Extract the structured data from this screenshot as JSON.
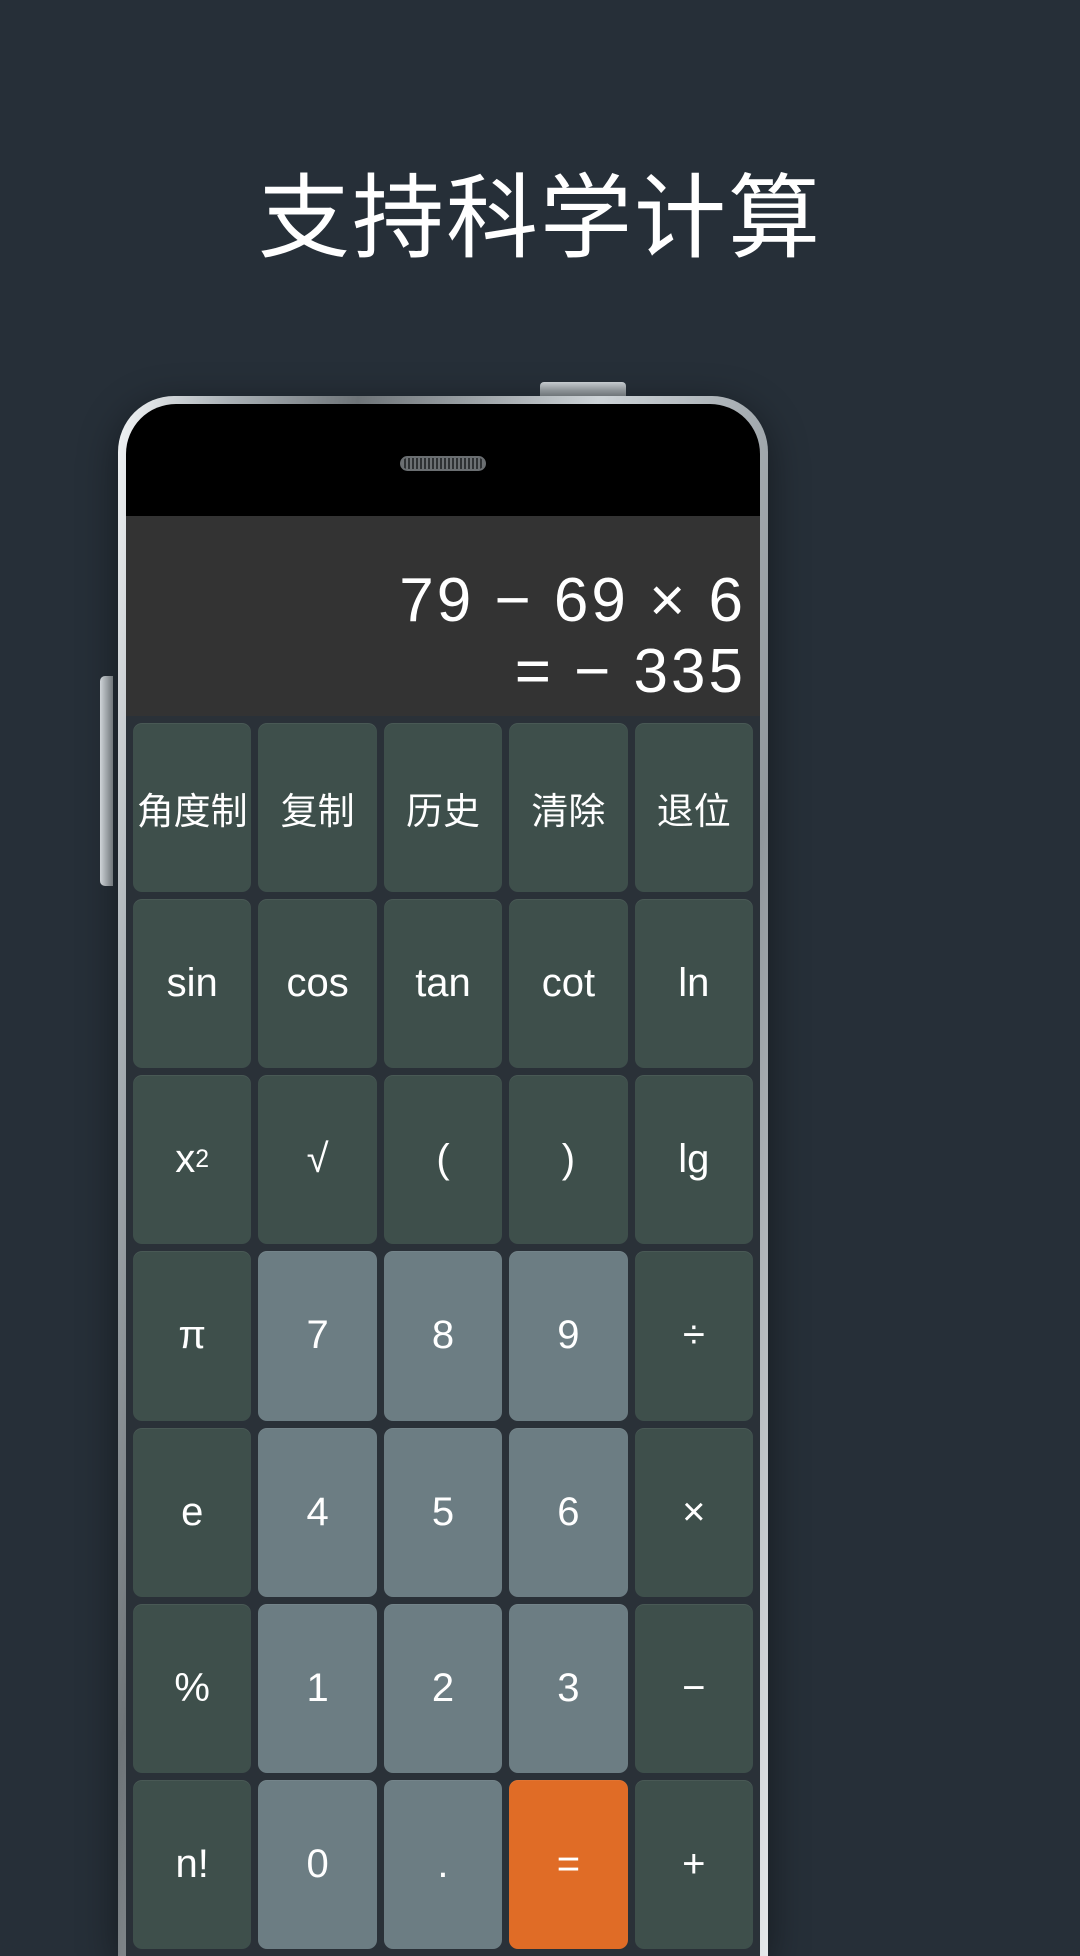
{
  "page": {
    "background_color": "#262f38",
    "headline": "支持科学计算"
  },
  "phone": {
    "frame_color": "#aab1b6",
    "bezel_color": "#000000",
    "earpiece_label": "earpiece-speaker",
    "power_button_label": "power-button",
    "volume_button_label": "volume-button"
  },
  "calculator": {
    "display": {
      "background_color": "#333333",
      "expression": "79 − 69 × 6",
      "result": "= − 335"
    },
    "colors": {
      "function_key": "#3e4f4b",
      "number_key": "#6c7d83",
      "equals_key": "#e06c26",
      "keypad_background": "#2a3138",
      "key_text": "#ffffff"
    },
    "keys": [
      {
        "label": "角度制",
        "type": "func",
        "name": "key-degree-mode",
        "cjk": true
      },
      {
        "label": "复制",
        "type": "func",
        "name": "key-copy",
        "cjk": true
      },
      {
        "label": "历史",
        "type": "func",
        "name": "key-history",
        "cjk": true
      },
      {
        "label": "清除",
        "type": "func",
        "name": "key-clear",
        "cjk": true
      },
      {
        "label": "退位",
        "type": "func",
        "name": "key-backspace",
        "cjk": true
      },
      {
        "label": "sin",
        "type": "func",
        "name": "key-sin"
      },
      {
        "label": "cos",
        "type": "func",
        "name": "key-cos"
      },
      {
        "label": "tan",
        "type": "func",
        "name": "key-tan"
      },
      {
        "label": "cot",
        "type": "func",
        "name": "key-cot"
      },
      {
        "label": "ln",
        "type": "func",
        "name": "key-ln"
      },
      {
        "label": "x²",
        "type": "func",
        "name": "key-square",
        "html": "x<sup>2</sup>"
      },
      {
        "label": "√",
        "type": "func",
        "name": "key-sqrt"
      },
      {
        "label": "(",
        "type": "func",
        "name": "key-left-paren"
      },
      {
        "label": ")",
        "type": "func",
        "name": "key-right-paren"
      },
      {
        "label": "lg",
        "type": "func",
        "name": "key-lg"
      },
      {
        "label": "π",
        "type": "func",
        "name": "key-pi"
      },
      {
        "label": "7",
        "type": "num",
        "name": "key-7"
      },
      {
        "label": "8",
        "type": "num",
        "name": "key-8"
      },
      {
        "label": "9",
        "type": "num",
        "name": "key-9"
      },
      {
        "label": "÷",
        "type": "func",
        "name": "key-divide"
      },
      {
        "label": "e",
        "type": "func",
        "name": "key-e"
      },
      {
        "label": "4",
        "type": "num",
        "name": "key-4"
      },
      {
        "label": "5",
        "type": "num",
        "name": "key-5"
      },
      {
        "label": "6",
        "type": "num",
        "name": "key-6"
      },
      {
        "label": "×",
        "type": "func",
        "name": "key-multiply"
      },
      {
        "label": "%",
        "type": "func",
        "name": "key-percent"
      },
      {
        "label": "1",
        "type": "num",
        "name": "key-1"
      },
      {
        "label": "2",
        "type": "num",
        "name": "key-2"
      },
      {
        "label": "3",
        "type": "num",
        "name": "key-3"
      },
      {
        "label": "−",
        "type": "func",
        "name": "key-minus"
      },
      {
        "label": "n!",
        "type": "func",
        "name": "key-factorial"
      },
      {
        "label": "0",
        "type": "num",
        "name": "key-0"
      },
      {
        "label": ".",
        "type": "num",
        "name": "key-decimal"
      },
      {
        "label": "=",
        "type": "equal",
        "name": "key-equals"
      },
      {
        "label": "+",
        "type": "func",
        "name": "key-plus"
      }
    ]
  }
}
